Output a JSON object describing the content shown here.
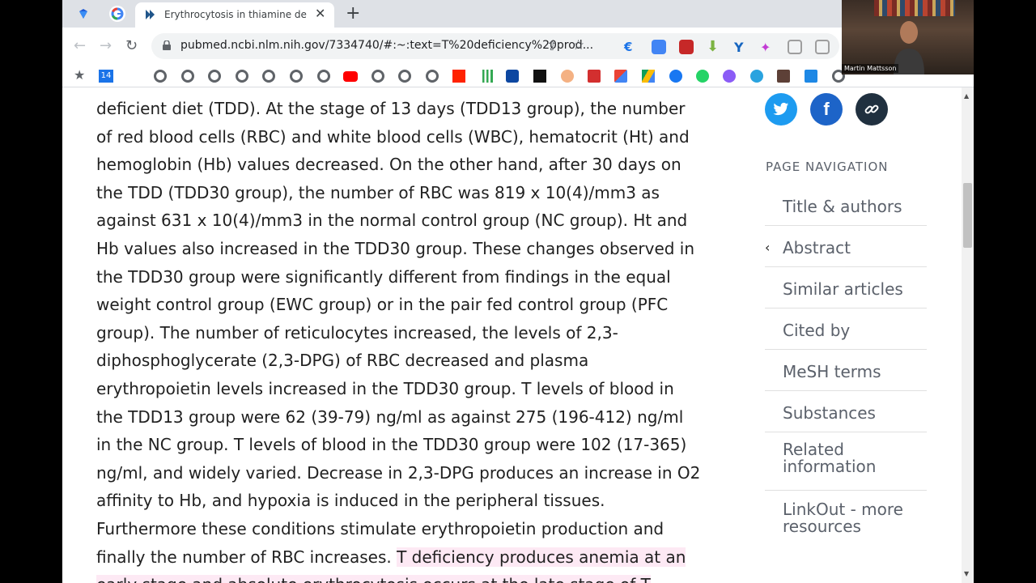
{
  "tabs": [
    {
      "title": "Erythrocytosis in thiamine defic",
      "active": true
    }
  ],
  "toolbar": {
    "url": "pubmed.ncbi.nlm.nih.gov/7334740/#:~:text=T%20deficiency%20prod..."
  },
  "bookmarks": {
    "calendar_day": "14"
  },
  "webcam": {
    "name": "Martin Mattsson"
  },
  "abstract": {
    "lines": [
      "deficient diet (TDD). At the stage of 13 days (TDD13 group), the number",
      "of red blood cells (RBC) and white blood cells (WBC), hematocrit (Ht) and",
      "hemoglobin (Hb) values decreased. On the other hand, after 30 days on",
      "the TDD (TDD30 group), the number of RBC was 819 x 10(4)/mm3 as",
      "against 631 x 10(4)/mm3 in the normal control group (NC group). Ht and",
      "Hb values also increased in the TDD30 group. These changes observed in",
      "the TDD30 group were significantly different from findings in the equal",
      "weight control group (EWC group) or in the pair fed control group (PFC",
      "group). The number of reticulocytes increased, the levels of 2,3-",
      "diphosphoglycerate (2,3-DPG) of RBC decreased and plasma",
      "erythropoietin levels increased in the TDD30 group. T levels of blood in",
      "the TDD13 group were 62 (39-79) ng/ml as against 275 (196-412) ng/ml",
      "in the NC group. T levels of blood in the TDD30 group were 102 (17-365)",
      "ng/ml, and widely varied. Decrease in 2,3-DPG produces an increase in O2",
      "affinity to Hb, and hypoxia is induced in the peripheral tissues.",
      "Furthermore these conditions stimulate erythropoietin production and"
    ],
    "last_line_plain": "finally the number of RBC increases. ",
    "last_line_highlight": "T deficiency produces anemia at an",
    "cut_line": "early stage and absolute erythrocytosis occurs at the late stage of T"
  },
  "page_navigation": {
    "title": "PAGE NAVIGATION",
    "items": [
      {
        "label": "Title & authors"
      },
      {
        "label": "Abstract"
      },
      {
        "label": "Similar articles"
      },
      {
        "label": "Cited by"
      },
      {
        "label": "MeSH terms"
      },
      {
        "label": "Substances"
      },
      {
        "label": "Related information"
      },
      {
        "label": "LinkOut - more resources"
      }
    ]
  },
  "colors": {
    "twitter": "#1d9bf0",
    "facebook": "#1d64c8",
    "link": "#20303f",
    "highlight": "#fde9f4"
  }
}
